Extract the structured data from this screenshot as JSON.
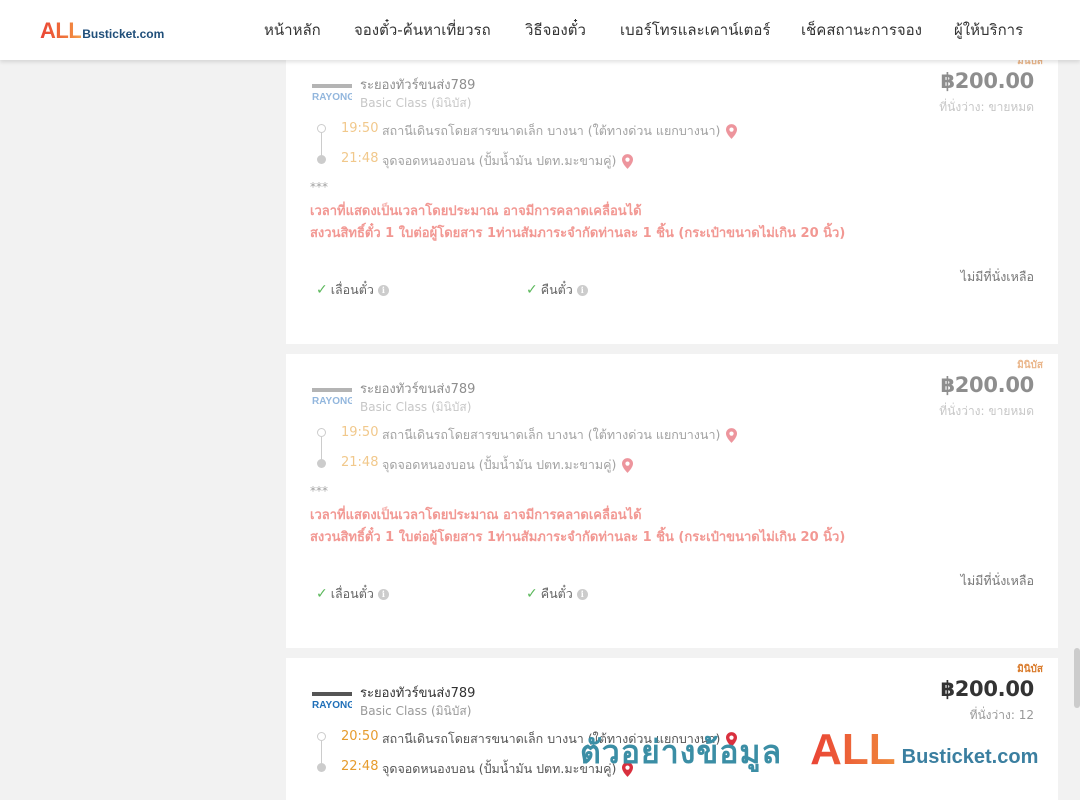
{
  "header": {
    "logo_all": "ALL",
    "logo_rest": "Busticket.com",
    "nav": [
      {
        "label": "หน้าหลัก"
      },
      {
        "label": "จองตั๋ว-ค้นหาเที่ยวรถ"
      },
      {
        "label": "วิธีจองตั๋ว"
      },
      {
        "label": "เบอร์โทรและเคาน์เตอร์"
      },
      {
        "label": "เช็คสถานะการจอง"
      },
      {
        "label": "ผู้ให้บริการ"
      }
    ]
  },
  "trips": [
    {
      "badge": "มินิบัส",
      "logo_text": "RAYONG",
      "operator": "ระยองทัวร์ขนส่ง789",
      "bus_class": "Basic Class (มินิบัส)",
      "price": "฿200.00",
      "seats": "ที่นั่งว่าง: ขายหมด",
      "dep_time": "19:50",
      "dep_stop": "สถานีเดินรถโดยสารขนาดเล็ก บางนา (ใต้ทางด่วน แยกบางนา)",
      "arr_time": "21:48",
      "arr_stop": "จุดจอดหนองบอน (ปั้มน้ำมัน ปตท.มะขามคู่)",
      "note_stars": "***",
      "note_1": "เวลาที่แสดงเป็นเวลาโดยประมาณ อาจมีการคลาดเคลื่อนได้",
      "note_2": "สงวนสิทธิ์ตั๋ว 1 ใบต่อผู้โดยสาร 1ท่านสัมภาระจำกัดท่านละ 1 ชิ้น (กระเป๋าขนาดไม่เกิน 20 นิ้ว)",
      "feature_change": "เลื่อนตั๋ว",
      "feature_refund": "คืนตั๋ว",
      "status": "ไม่มีที่นั่งเหลือ"
    },
    {
      "badge": "มินิบัส",
      "logo_text": "RAYONG",
      "operator": "ระยองทัวร์ขนส่ง789",
      "bus_class": "Basic Class (มินิบัส)",
      "price": "฿200.00",
      "seats": "ที่นั่งว่าง: ขายหมด",
      "dep_time": "19:50",
      "dep_stop": "สถานีเดินรถโดยสารขนาดเล็ก บางนา (ใต้ทางด่วน แยกบางนา)",
      "arr_time": "21:48",
      "arr_stop": "จุดจอดหนองบอน (ปั้มน้ำมัน ปตท.มะขามคู่)",
      "note_stars": "***",
      "note_1": "เวลาที่แสดงเป็นเวลาโดยประมาณ อาจมีการคลาดเคลื่อนได้",
      "note_2": "สงวนสิทธิ์ตั๋ว 1 ใบต่อผู้โดยสาร 1ท่านสัมภาระจำกัดท่านละ 1 ชิ้น (กระเป๋าขนาดไม่เกิน 20 นิ้ว)",
      "feature_change": "เลื่อนตั๋ว",
      "feature_refund": "คืนตั๋ว",
      "status": "ไม่มีที่นั่งเหลือ"
    },
    {
      "badge": "มินิบัส",
      "logo_text": "RAYONG",
      "operator": "ระยองทัวร์ขนส่ง789",
      "bus_class": "Basic Class (มินิบัส)",
      "price": "฿200.00",
      "seats": "ที่นั่งว่าง: 12",
      "dep_time": "20:50",
      "dep_stop": "สถานีเดินรถโดยสารขนาดเล็ก บางนา (ใต้ทางด่วน แยกบางนา)",
      "arr_time": "22:48",
      "arr_stop": "จุดจอดหนองบอน (ปั้มน้ำมัน ปตท.มะขามคู่)"
    }
  ],
  "watermark": {
    "text": "ตัวอย่างข้อมูล",
    "all": "ALL",
    "rest": "Busticket.com"
  },
  "colors": {
    "brand_red": "#ea4335",
    "brand_blue": "#1f4e79",
    "time_orange": "#e69c2e",
    "note_red": "#e8453c",
    "check_green": "#5cb85c"
  }
}
